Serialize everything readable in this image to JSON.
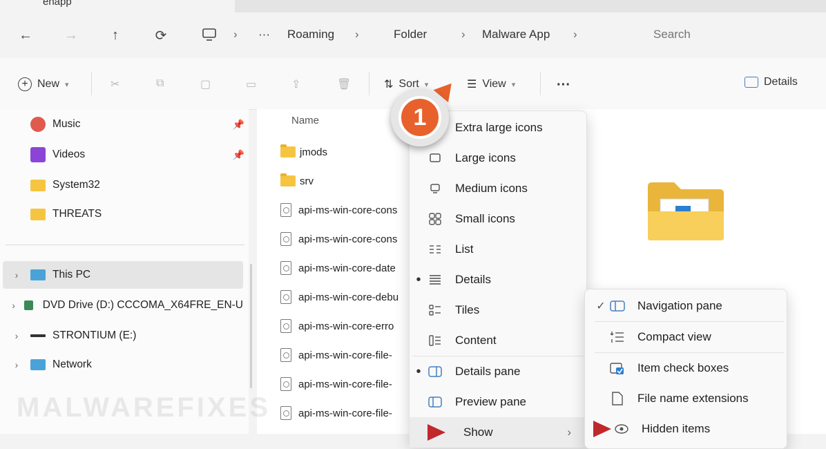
{
  "tab": {
    "label": "enapp"
  },
  "breadcrumb": {
    "overflow": "···",
    "items": [
      "Roaming",
      "Folder",
      "Malware App"
    ]
  },
  "search": {
    "placeholder": "Search"
  },
  "commands": {
    "new": "New",
    "sort": "Sort",
    "view": "View",
    "more": "···",
    "details": "Details"
  },
  "nav": {
    "quick": [
      {
        "label": "Music",
        "icon": "music-icon",
        "color": "#e05a4e"
      },
      {
        "label": "Videos",
        "icon": "videos-icon",
        "color": "#8b44d6"
      },
      {
        "label": "System32",
        "icon": "folder-icon",
        "color": "#f5c542"
      },
      {
        "label": "THREATS",
        "icon": "folder-icon",
        "color": "#f5c542"
      }
    ],
    "drives": [
      {
        "label": "This PC",
        "icon": "pc-icon"
      },
      {
        "label": "DVD Drive (D:) CCCOMA_X64FRE_EN-U",
        "icon": "dvd-icon"
      },
      {
        "label": "STRONTIUM (E:)",
        "icon": "usb-drive-icon"
      },
      {
        "label": "Network",
        "icon": "network-icon"
      }
    ]
  },
  "filelist": {
    "column": "Name",
    "folders": [
      "jmods",
      "srv"
    ],
    "files": [
      "api-ms-win-core-cons",
      "api-ms-win-core-cons",
      "api-ms-win-core-date",
      "api-ms-win-core-debu",
      "api-ms-win-core-erro",
      "api-ms-win-core-file-",
      "api-ms-win-core-file-",
      "api-ms-win-core-file-"
    ]
  },
  "view_menu": {
    "items": [
      {
        "label": "Extra large icons",
        "bullet": ""
      },
      {
        "label": "Large icons",
        "bullet": ""
      },
      {
        "label": "Medium icons",
        "bullet": ""
      },
      {
        "label": "Small icons",
        "bullet": ""
      },
      {
        "label": "List",
        "bullet": ""
      },
      {
        "label": "Details",
        "bullet": "•"
      },
      {
        "label": "Tiles",
        "bullet": ""
      },
      {
        "label": "Content",
        "bullet": ""
      }
    ],
    "panes": [
      {
        "label": "Details pane",
        "bullet": "•"
      },
      {
        "label": "Preview pane",
        "bullet": ""
      }
    ],
    "show": "Show"
  },
  "show_menu": {
    "items": [
      {
        "label": "Navigation pane",
        "check": "✓"
      },
      {
        "label": "Compact view",
        "check": ""
      },
      {
        "label": "Item check boxes",
        "check": ""
      },
      {
        "label": "File name extensions",
        "check": ""
      },
      {
        "label": "Hidden items",
        "check": ""
      }
    ]
  },
  "callout": {
    "number": "1"
  },
  "watermark": "MALWAREFIXES",
  "colors": {
    "accent": "#e8612c",
    "arrow": "#c0282b",
    "folder": "#f5c542"
  }
}
